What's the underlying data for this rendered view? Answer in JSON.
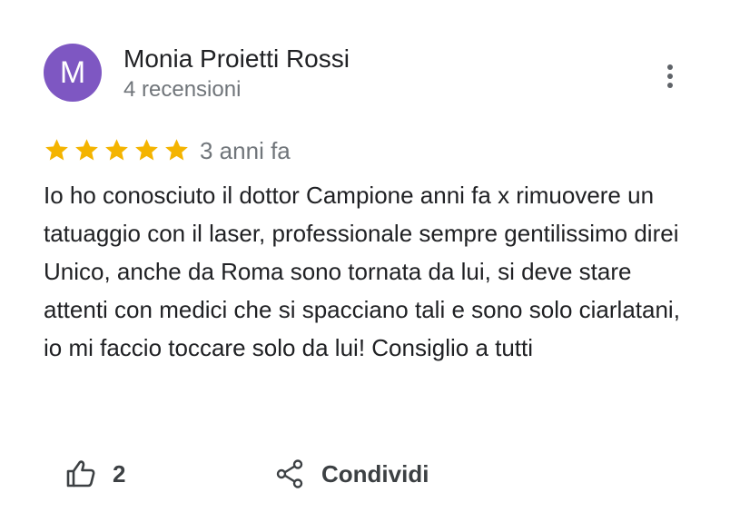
{
  "review": {
    "author": {
      "initial": "M",
      "name": "Monia Proietti Rossi",
      "review_count": "4 recensioni",
      "avatar_color": "#7e57c2"
    },
    "rating": 5,
    "max_rating": 5,
    "star_color": "#f4b400",
    "date": "3 anni fa",
    "text": "Io ho conosciuto il dottor Campione anni fa x rimuovere un tatuaggio con il laser, professionale sempre gentilissimo direi Unico, anche da Roma sono tornata da lui, si deve stare attenti con medici che si spacciano tali e sono solo ciarlatani, io mi faccio toccare solo da lui! Consiglio a tutti"
  },
  "actions": {
    "like_count": "2",
    "share_label": "Condividi"
  },
  "icons": {
    "more": "more-vert-icon",
    "like": "thumb-up-icon",
    "share": "share-icon"
  }
}
